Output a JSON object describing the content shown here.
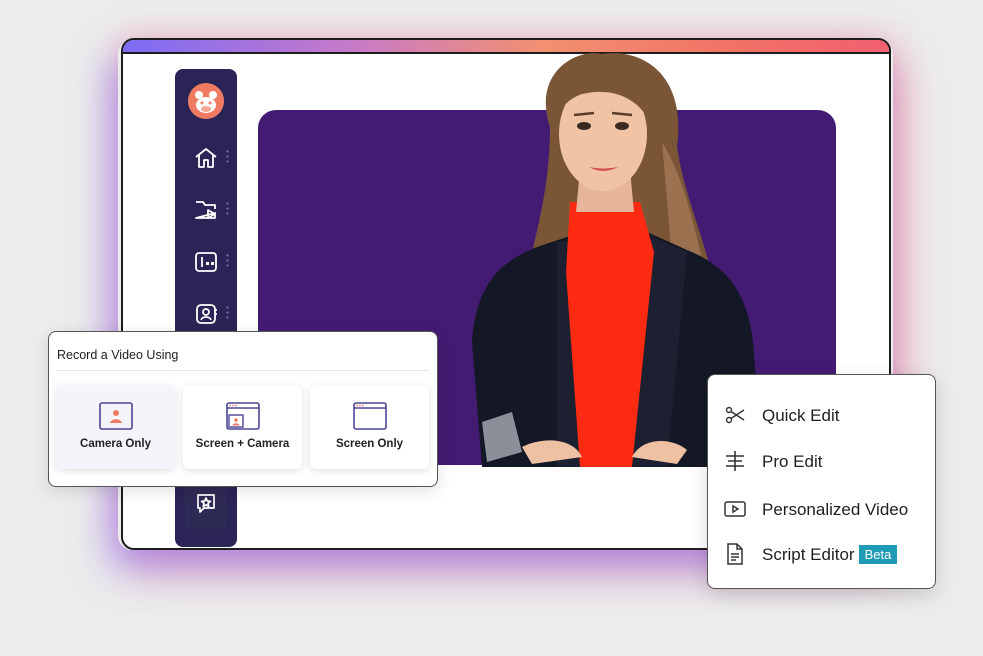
{
  "record_panel": {
    "title": "Record a Video Using",
    "options": [
      {
        "label": "Camera Only",
        "icon": "camera-icon"
      },
      {
        "label": "Screen + Camera",
        "icon": "screen-camera-icon"
      },
      {
        "label": "Screen Only",
        "icon": "screen-icon"
      }
    ]
  },
  "edit_menu": {
    "items": [
      {
        "label": "Quick Edit",
        "icon": "scissors-icon"
      },
      {
        "label": "Pro Edit",
        "icon": "timeline-icon"
      },
      {
        "label": "Personalized Video",
        "icon": "play-video-icon"
      },
      {
        "label": "Script Editor",
        "icon": "document-icon",
        "badge": "Beta"
      }
    ]
  },
  "sidebar": {
    "items": [
      {
        "icon": "home-icon"
      },
      {
        "icon": "video-folder-icon"
      },
      {
        "icon": "media-library-icon"
      },
      {
        "icon": "contacts-icon"
      },
      {
        "icon": "star-chat-icon"
      }
    ]
  },
  "colors": {
    "sidebar": "#2b2456",
    "stage": "#441b73",
    "accent_badge": "#1e9bb5",
    "logo": "#f07b63"
  }
}
